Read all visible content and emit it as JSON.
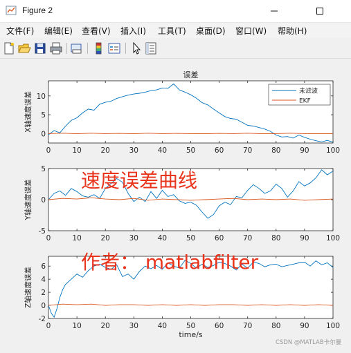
{
  "window": {
    "title": "Figure 2"
  },
  "menu": [
    {
      "label": "文件(F)"
    },
    {
      "label": "编辑(E)"
    },
    {
      "label": "查看(V)"
    },
    {
      "label": "插入(I)"
    },
    {
      "label": "工具(T)"
    },
    {
      "label": "桌面(D)"
    },
    {
      "label": "窗口(W)"
    },
    {
      "label": "帮助(H)"
    }
  ],
  "toolbar_icons": [
    "new-figure-icon",
    "open-file-icon",
    "save-icon",
    "print-icon",
    "print-preview-icon",
    "insert-colorbar-icon",
    "insert-legend-icon",
    "pointer-icon",
    "property-inspector-icon"
  ],
  "overlay": {
    "caption1": "速度误差曲线",
    "caption2": "作者：  matlabfilter",
    "watermark": "CSDN @MATLAB卡尔曼",
    "color": "#e8341c"
  },
  "chart_data": [
    {
      "type": "line",
      "title": "误差",
      "ylabel": "X轴速度误差",
      "xlabel": "",
      "xlim": [
        0,
        100
      ],
      "ylim": [
        -2.5,
        14
      ],
      "xticks": [
        0,
        10,
        20,
        30,
        40,
        50,
        60,
        70,
        80,
        90,
        100
      ],
      "yticks": [
        0,
        5,
        10
      ],
      "legend": {
        "position": "top-right",
        "entries": [
          "未滤波",
          "EKF"
        ]
      },
      "colors": [
        "#0072bd",
        "#d95319"
      ],
      "series": [
        {
          "name": "未滤波",
          "x": [
            0,
            2,
            4,
            6,
            8,
            10,
            12,
            14,
            16,
            18,
            20,
            22,
            24,
            26,
            28,
            30,
            32,
            34,
            36,
            38,
            40,
            42,
            44,
            46,
            48,
            50,
            52,
            54,
            56,
            58,
            60,
            62,
            64,
            66,
            68,
            70,
            72,
            74,
            76,
            78,
            80,
            82,
            84,
            86,
            88,
            90,
            92,
            94,
            96,
            98,
            100
          ],
          "y": [
            -0.3,
            0.8,
            0.2,
            2.0,
            3.5,
            4.2,
            5.5,
            6.5,
            6.2,
            7.8,
            8.3,
            8.6,
            9.3,
            9.8,
            10.2,
            10.5,
            10.7,
            11.0,
            11.4,
            11.6,
            12.1,
            12.0,
            13.2,
            11.6,
            11.0,
            10.3,
            9.4,
            8.2,
            7.6,
            6.5,
            5.5,
            4.5,
            4.0,
            3.8,
            3.0,
            2.2,
            2.0,
            1.6,
            1.2,
            0.6,
            -0.4,
            -0.9,
            -0.8,
            -1.2,
            -0.4,
            -1.0,
            -1.5,
            -1.9,
            -2.2,
            -1.8,
            -2.3
          ]
        },
        {
          "name": "EKF",
          "x": [
            0,
            5,
            10,
            15,
            20,
            25,
            30,
            35,
            40,
            45,
            50,
            55,
            60,
            65,
            70,
            75,
            80,
            85,
            90,
            95,
            100
          ],
          "y": [
            0.0,
            0.1,
            -0.05,
            0.1,
            0.0,
            0.05,
            -0.05,
            0.1,
            0.0,
            0.05,
            0.0,
            -0.05,
            0.05,
            0.0,
            0.1,
            -0.05,
            0.0,
            0.1,
            0.0,
            -0.05,
            0.0
          ]
        }
      ]
    },
    {
      "type": "line",
      "title": "",
      "ylabel": "Y轴速度误差",
      "xlabel": "",
      "xlim": [
        0,
        100
      ],
      "ylim": [
        -5,
        5
      ],
      "xticks": [
        0,
        10,
        20,
        30,
        40,
        50,
        60,
        70,
        80,
        90,
        100
      ],
      "yticks": [
        -5,
        0,
        5
      ],
      "colors": [
        "#0072bd",
        "#d95319"
      ],
      "series": [
        {
          "name": "未滤波",
          "x": [
            0,
            2,
            4,
            6,
            8,
            10,
            12,
            14,
            16,
            18,
            20,
            22,
            24,
            26,
            28,
            30,
            32,
            34,
            36,
            38,
            40,
            42,
            44,
            46,
            48,
            50,
            52,
            54,
            56,
            58,
            60,
            62,
            64,
            66,
            68,
            70,
            72,
            74,
            76,
            78,
            80,
            82,
            84,
            86,
            88,
            90,
            92,
            94,
            96,
            98,
            100
          ],
          "y": [
            0.0,
            1.0,
            1.4,
            0.7,
            1.8,
            1.3,
            0.6,
            0.4,
            0.8,
            0.2,
            1.8,
            2.6,
            3.4,
            2.8,
            1.0,
            -0.3,
            0.4,
            -0.3,
            1.3,
            0.2,
            1.5,
            0.5,
            0.8,
            -0.2,
            -0.6,
            -0.4,
            -0.9,
            -2.0,
            -3.0,
            -2.4,
            -1.0,
            -0.4,
            -0.8,
            0.5,
            0.3,
            1.5,
            2.4,
            1.8,
            1.0,
            1.4,
            2.5,
            1.8,
            0.4,
            1.4,
            2.9,
            2.2,
            2.7,
            3.5,
            4.8,
            4.0,
            4.6
          ]
        },
        {
          "name": "EKF",
          "x": [
            0,
            5,
            10,
            15,
            20,
            25,
            30,
            35,
            40,
            45,
            50,
            55,
            60,
            65,
            70,
            75,
            80,
            85,
            90,
            95,
            100
          ],
          "y": [
            0.0,
            0.2,
            0.1,
            0.3,
            0.1,
            0.0,
            0.2,
            -0.1,
            0.1,
            0.0,
            -0.1,
            0.0,
            0.1,
            0.2,
            0.0,
            0.1,
            0.0,
            0.1,
            -0.1,
            0.0,
            0.1
          ]
        }
      ]
    },
    {
      "type": "line",
      "title": "",
      "ylabel": "Z轴速度误差",
      "xlabel": "time/s",
      "xlim": [
        0,
        100
      ],
      "ylim": [
        -2,
        7.5
      ],
      "xticks": [
        0,
        10,
        20,
        30,
        40,
        50,
        60,
        70,
        80,
        90,
        100
      ],
      "yticks": [
        -2,
        0,
        2,
        4,
        6
      ],
      "colors": [
        "#0072bd",
        "#d95319"
      ],
      "series": [
        {
          "name": "未滤波",
          "x": [
            0,
            1,
            2,
            3,
            4,
            5,
            6,
            8,
            10,
            12,
            14,
            16,
            18,
            20,
            22,
            24,
            26,
            28,
            30,
            32,
            34,
            36,
            38,
            40,
            42,
            44,
            46,
            48,
            50,
            52,
            54,
            56,
            58,
            60,
            62,
            64,
            66,
            68,
            70,
            72,
            74,
            76,
            78,
            80,
            82,
            84,
            86,
            88,
            90,
            92,
            94,
            96,
            98,
            100
          ],
          "y": [
            0.0,
            -1.2,
            -1.8,
            -0.5,
            1.2,
            2.4,
            3.2,
            4.0,
            4.8,
            4.3,
            5.3,
            6.0,
            6.3,
            5.8,
            5.5,
            6.2,
            4.4,
            4.8,
            4.0,
            5.2,
            6.0,
            5.6,
            6.1,
            5.5,
            6.5,
            6.0,
            5.7,
            6.9,
            6.4,
            5.7,
            6.3,
            5.8,
            6.1,
            6.6,
            6.4,
            6.0,
            5.4,
            6.3,
            5.7,
            6.6,
            6.4,
            5.9,
            6.2,
            6.3,
            5.9,
            6.1,
            6.3,
            6.5,
            6.6,
            6.0,
            6.8,
            6.2,
            6.5,
            5.8
          ]
        },
        {
          "name": "EKF",
          "x": [
            0,
            5,
            10,
            15,
            20,
            25,
            30,
            35,
            40,
            45,
            50,
            55,
            60,
            65,
            70,
            75,
            80,
            85,
            90,
            95,
            100
          ],
          "y": [
            0.0,
            0.2,
            0.1,
            0.2,
            0.0,
            0.1,
            0.1,
            0.0,
            0.1,
            0.0,
            0.1,
            0.0,
            0.1,
            0.1,
            0.0,
            0.1,
            0.0,
            0.1,
            0.0,
            0.1,
            0.0
          ]
        }
      ]
    }
  ]
}
